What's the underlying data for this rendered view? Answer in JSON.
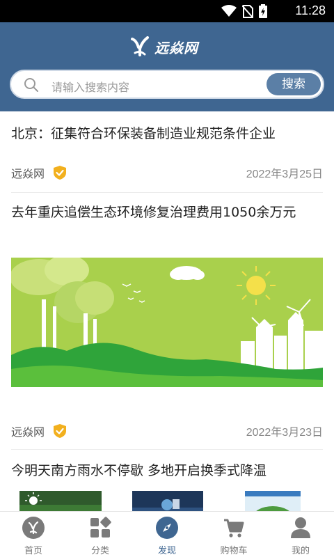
{
  "status_bar": {
    "time": "11:28"
  },
  "header": {
    "logo_text": "远焱网",
    "search": {
      "placeholder": "请输入搜索内容",
      "button_label": "搜索"
    }
  },
  "articles": [
    {
      "title": "北京：征集符合环保装备制造业规范条件企业",
      "source": "远焱网",
      "date": "2022年3月25日"
    },
    {
      "title": "去年重庆追偿生态环境修复治理费用1050余万元",
      "source": "远焱网",
      "date": "2022年3月23日"
    },
    {
      "title": "今明天南方雨水不停歇 多地开启换季式降温"
    }
  ],
  "tabs": [
    {
      "label": "首页",
      "icon": "home-icon",
      "active": false
    },
    {
      "label": "分类",
      "icon": "category-icon",
      "active": false
    },
    {
      "label": "发现",
      "icon": "compass-icon",
      "active": true
    },
    {
      "label": "购物车",
      "icon": "cart-icon",
      "active": false
    },
    {
      "label": "我的",
      "icon": "user-icon",
      "active": false
    }
  ],
  "colors": {
    "header_bg": "#3f6691",
    "accent": "#3f6691",
    "badge": "#f2b01e",
    "search_button": "#5b7fa6"
  }
}
